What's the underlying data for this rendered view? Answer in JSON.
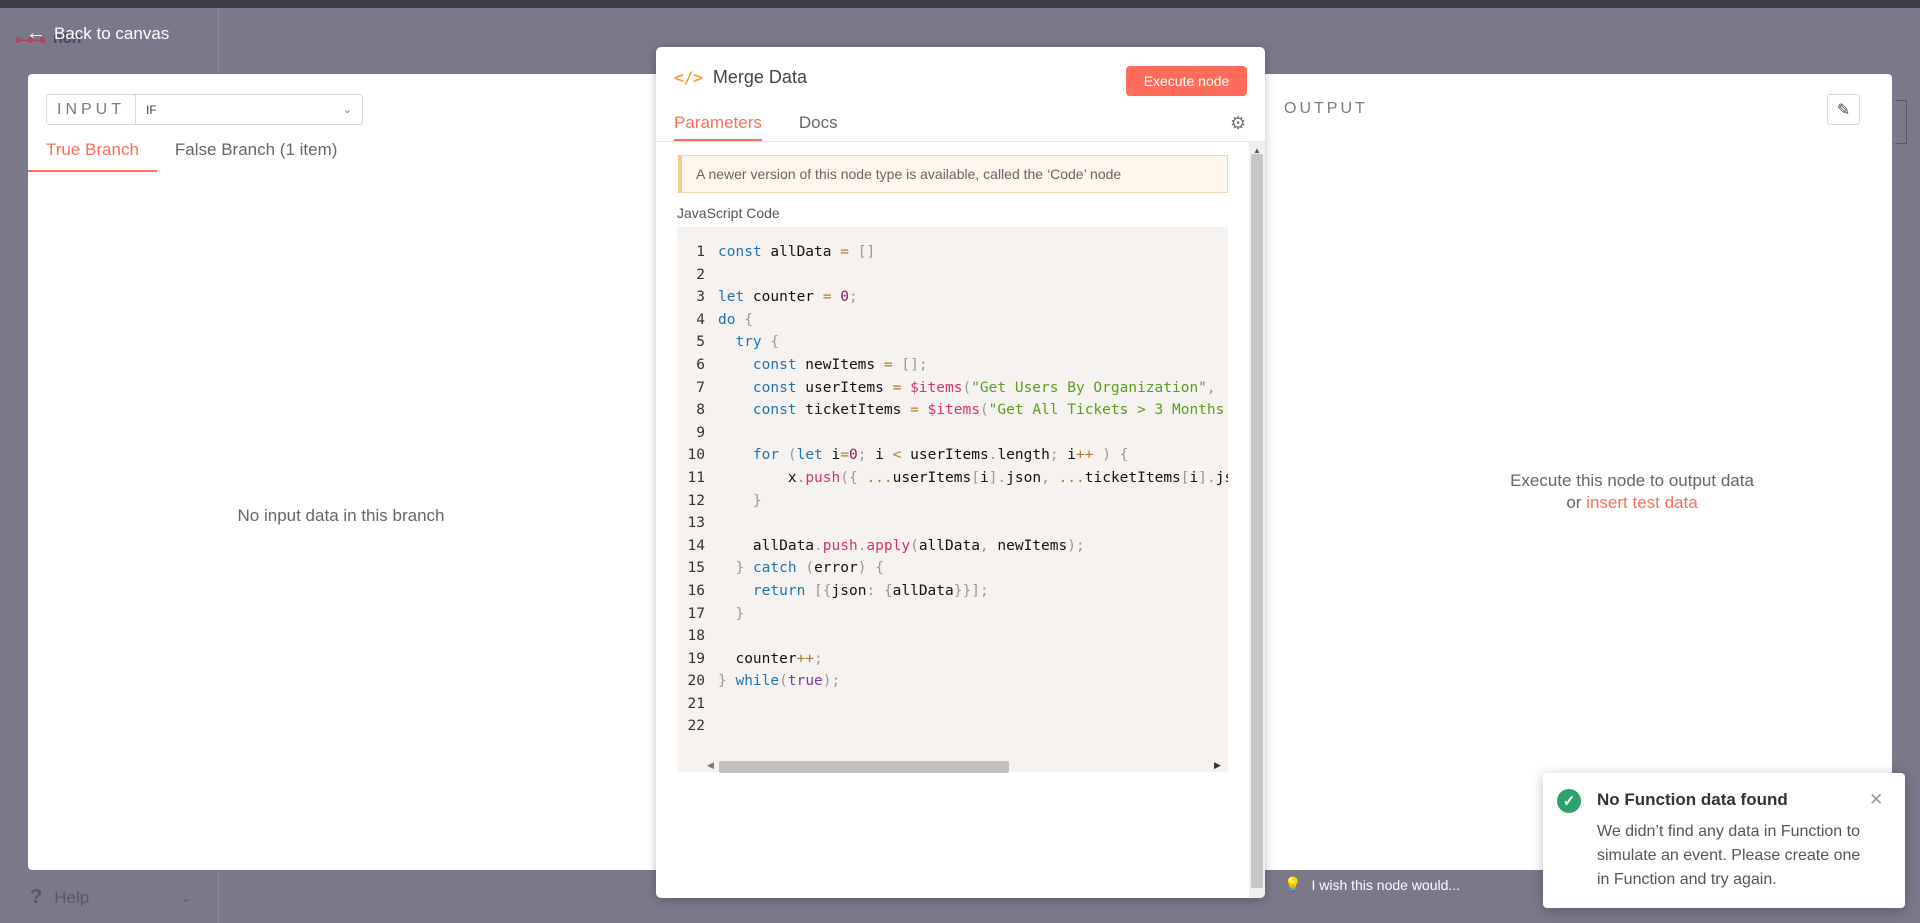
{
  "app": {
    "logo_text": "n8n",
    "back_label": "Back to canvas",
    "help_label": "Help"
  },
  "input_panel": {
    "label": "INPUT",
    "selected_node": "IF",
    "tabs": [
      {
        "label": "True Branch",
        "active": true
      },
      {
        "label": "False Branch (1 item)",
        "active": false
      }
    ],
    "empty_message": "No input data in this branch"
  },
  "dialog": {
    "title": "Merge Data",
    "execute_label": "Execute node",
    "tabs": [
      {
        "label": "Parameters",
        "active": true
      },
      {
        "label": "Docs",
        "active": false
      }
    ],
    "notice": "A newer version of this node type is available, called the ‘Code’ node",
    "code_label": "JavaScript Code",
    "code_lines": [
      "const allData = []",
      "",
      "let counter = 0;",
      "do {",
      "  try {",
      "    const newItems = [];",
      "    const userItems = $items(\"Get Users By Organization\",",
      "    const ticketItems = $items(\"Get All Tickets > 3 Months",
      "",
      "    for (let i=0; i < userItems.length; i++ ) {",
      "        x.push({ ...userItems[i].json, ...ticketItems[i].js",
      "    }",
      "",
      "    allData.push.apply(allData, newItems);",
      "  } catch (error) {",
      "    return [{json: {allData}}];",
      "  }",
      "",
      "  counter++;",
      "} while(true);",
      "",
      ""
    ]
  },
  "output_panel": {
    "label": "OUTPUT",
    "message_line1": "Execute this node to output data",
    "message_or": "or",
    "message_link": "insert test data",
    "wish_label": "I wish this node would..."
  },
  "toast": {
    "title": "No Function data found",
    "body": "We didn’t find any data in Function to simulate an event. Please create one in Function and try again."
  },
  "colors": {
    "accent": "#ff6d5a",
    "success": "#2ca36f",
    "overlay": "#7b7889"
  }
}
